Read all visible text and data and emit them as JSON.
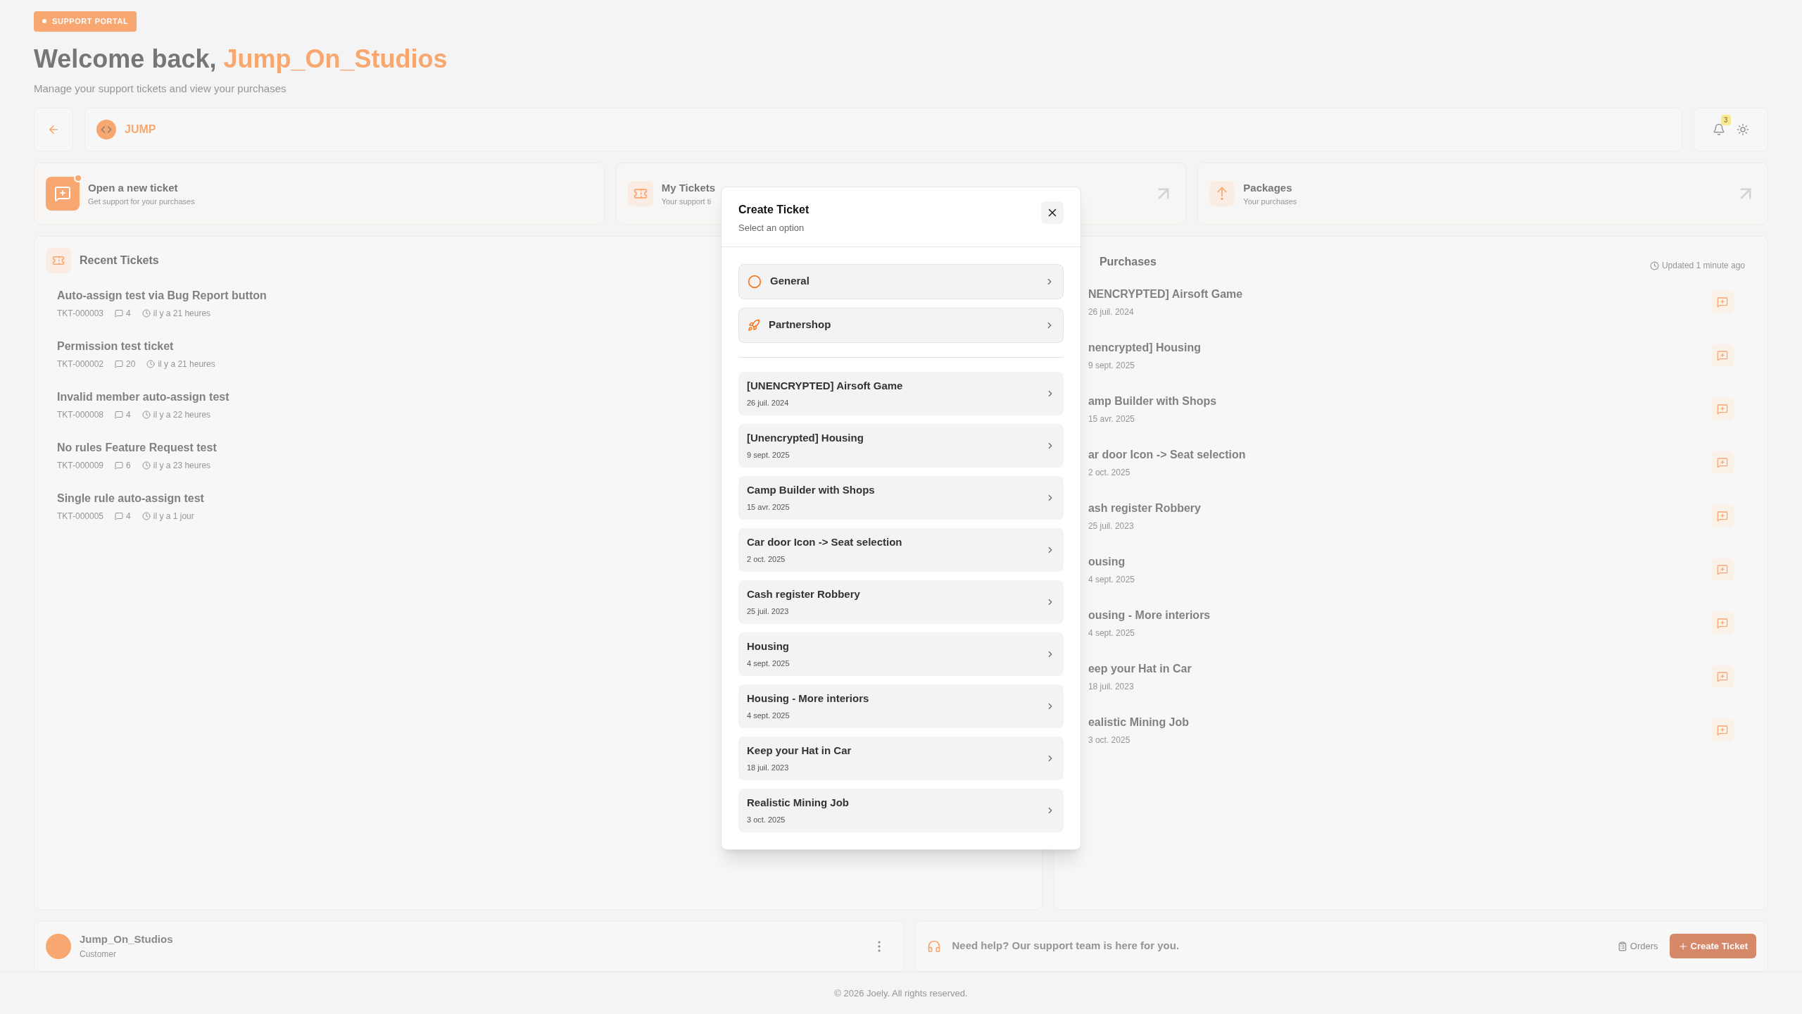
{
  "header": {
    "badge": "SUPPORT PORTAL",
    "greeting": "Welcome back,",
    "name": "Jump_On_Studios",
    "subtitle": "Manage your support tickets and view your purchases"
  },
  "nav": {
    "brand": "JUMP",
    "notifications": "3"
  },
  "cards": [
    {
      "kind": "primary",
      "title": "Open a new ticket",
      "subtitle": "Get support for your purchases"
    },
    {
      "kind": "link",
      "title": "My Tickets",
      "subtitle": "Your support ti"
    },
    {
      "kind": "link",
      "title": "Packages",
      "subtitle": "Your purchases"
    }
  ],
  "recent_tickets": {
    "title": "Recent Tickets",
    "items": [
      {
        "title": "Auto-assign test via Bug Report button",
        "id": "TKT-000003",
        "comments": "4",
        "time": "il y a 21 heures"
      },
      {
        "title": "Permission test ticket",
        "id": "TKT-000002",
        "comments": "20",
        "time": "il y a 21 heures"
      },
      {
        "title": "Invalid member auto-assign test",
        "id": "TKT-000008",
        "comments": "4",
        "time": "il y a 22 heures"
      },
      {
        "title": "No rules Feature Request test",
        "id": "TKT-000009",
        "comments": "6",
        "time": "il y a 23 heures"
      },
      {
        "title": "Single rule auto-assign test",
        "id": "TKT-000005",
        "comments": "4",
        "time": "il y a 1 jour"
      }
    ]
  },
  "purchases": {
    "title": "Purchases",
    "updated": "Updated 1 minute ago",
    "items": [
      {
        "name": "NENCRYPTED] Airsoft Game",
        "date": "26 juil. 2024"
      },
      {
        "name": "nencrypted] Housing",
        "date": "9 sept. 2025"
      },
      {
        "name": "amp Builder with Shops",
        "date": "15 avr. 2025"
      },
      {
        "name": "ar door Icon -> Seat selection",
        "date": "2 oct. 2025"
      },
      {
        "name": "ash register Robbery",
        "date": "25 juil. 2023"
      },
      {
        "name": "ousing",
        "date": "4 sept. 2025"
      },
      {
        "name": "ousing - More interiors",
        "date": "4 sept. 2025"
      },
      {
        "name": "eep your Hat in Car",
        "date": "18 juil. 2023"
      },
      {
        "name": "ealistic Mining Job",
        "date": "3 oct. 2025"
      }
    ]
  },
  "user": {
    "name": "Jump_On_Studios",
    "role": "Customer"
  },
  "help": {
    "text": "Need help? Our support team is here for you.",
    "orders": "Orders",
    "create": "Create Ticket"
  },
  "footer": "© 2026 Joely. All rights reserved.",
  "modal": {
    "title": "Create Ticket",
    "subtitle": "Select an option",
    "options": [
      {
        "kind": "general",
        "label": "General"
      },
      {
        "kind": "partnership",
        "label": "Partnershop"
      }
    ],
    "products": [
      {
        "name": "[UNENCRYPTED] Airsoft Game",
        "date": "26 juil. 2024"
      },
      {
        "name": "[Unencrypted] Housing",
        "date": "9 sept. 2025"
      },
      {
        "name": "Camp Builder with Shops",
        "date": "15 avr. 2025"
      },
      {
        "name": "Car door Icon -> Seat selection",
        "date": "2 oct. 2025"
      },
      {
        "name": "Cash register Robbery",
        "date": "25 juil. 2023"
      },
      {
        "name": "Housing",
        "date": "4 sept. 2025"
      },
      {
        "name": "Housing - More interiors",
        "date": "4 sept. 2025"
      },
      {
        "name": "Keep your Hat in Car",
        "date": "18 juil. 2023"
      },
      {
        "name": "Realistic Mining Job",
        "date": "3 oct. 2025"
      }
    ]
  }
}
